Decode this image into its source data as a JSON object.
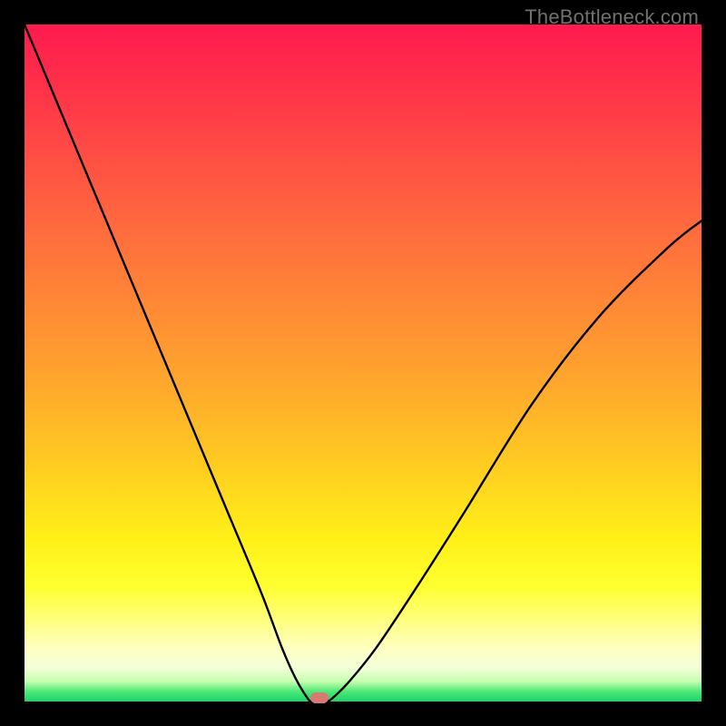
{
  "attribution": "TheBottleneck.com",
  "colors": {
    "frame": "#000000",
    "curve": "#000000",
    "marker": "#d77a72"
  },
  "chart_data": {
    "type": "line",
    "title": "",
    "xlabel": "",
    "ylabel": "",
    "xlim": [
      0,
      100
    ],
    "ylim": [
      0,
      100
    ],
    "grid": false,
    "legend": false,
    "background": "rainbow-gradient-vertical",
    "series": [
      {
        "name": "bottleneck-curve",
        "x": [
          0,
          5,
          10,
          15,
          20,
          25,
          30,
          35,
          38,
          40,
          41.8,
          42.5,
          44.5,
          45.5,
          48,
          52,
          58,
          65,
          75,
          85,
          95,
          100
        ],
        "y": [
          100,
          88,
          76,
          64,
          52,
          40,
          28,
          16,
          8,
          3.5,
          0.5,
          0,
          0,
          0.5,
          3,
          8,
          17,
          28,
          44,
          57,
          67,
          71
        ]
      }
    ],
    "marker": {
      "x": 43.5,
      "y": 0
    }
  }
}
